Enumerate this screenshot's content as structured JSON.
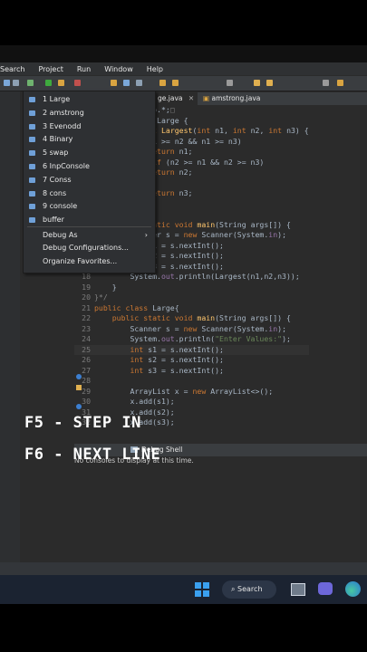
{
  "menubar": [
    "Search",
    "Project",
    "Run",
    "Window",
    "Help"
  ],
  "tabs": [
    "ge.java",
    "amstrong.java"
  ],
  "editor": {
    "lines": [
      {
        "n": "",
        "html": "           <span class='pl'>.io.*;</span><span class='cm'>□</span>"
      },
      {
        "n": "",
        "html": "           <span class='kw'>ss</span> <span class='pl'>Large {</span>"
      },
      {
        "n": "",
        "html": "           <span class='kw'>int</span> <span class='fn'>Largest</span><span class='pl'>(</span><span class='kw'>int</span> <span class='pl'>n1, </span><span class='kw'>int</span> <span class='pl'>n2, </span><span class='kw'>int</span> <span class='pl'>n3) {</span>"
      },
      {
        "n": "",
        "html": "           <span class='pl'>(n1 >= n2 && n1 >= n3)</span>"
      },
      {
        "n": "",
        "html": "            <span class='kw'>return</span> <span class='pl'>n1;</span>"
      },
      {
        "n": "",
        "html": "           <span class='kw'>e if</span> <span class='pl'>(n2 >= n1 && n2 >= n3)</span>"
      },
      {
        "n": "",
        "html": "            <span class='kw'>return</span> <span class='pl'>n2;</span>"
      },
      {
        "n": "",
        "html": ""
      },
      {
        "n": "",
        "html": "            <span class='kw'>return</span> <span class='pl'>n3;</span>"
      },
      {
        "n": "",
        "html": ""
      },
      {
        "n": "",
        "html": ""
      },
      {
        "n": "",
        "html": "           <span class='kw'>static void</span> <span class='fn'>main</span><span class='pl'>(String </span><span class='pl'>args[]) {</span>"
      },
      {
        "n": "",
        "html": "           <span class='pl'>nner s = </span><span class='kw'>new</span> <span class='pl'>Scanner(System.</span><span class='var'>in</span><span class='pl'>);</span>"
      },
      {
        "n": "",
        "html": "            <span class='pl'>n1 = s.nextInt();</span>"
      },
      {
        "n": "",
        "html": "            <span class='pl'>n2 = s.nextInt();</span>"
      },
      {
        "n": "",
        "html": "            <span class='pl'>n3 = s.nextInt();</span>"
      },
      {
        "n": "18",
        "html": "        <span class='pl'>System.</span><span class='var'>out</span><span class='pl'>.println(Largest(n1,n2,n3));</span>"
      },
      {
        "n": "19",
        "html": "    <span class='pl'>}</span>"
      },
      {
        "n": "20",
        "html": "<span class='cm'>}*/</span>"
      },
      {
        "n": "21",
        "html": "<span class='kw'>public class</span> <span class='pl'>Large{</span>"
      },
      {
        "n": "22",
        "html": "    <span class='kw'>public static void</span> <span class='fn'>main</span><span class='pl'>(String </span><span class='pl'>args[]) {</span>"
      },
      {
        "n": "23",
        "html": "        <span class='pl'>Scanner </span><span class='pl'>s</span><span class='pl'> = </span><span class='kw'>new</span> <span class='pl'>Scanner(System.</span><span class='var'>in</span><span class='pl'>);</span>"
      },
      {
        "n": "24",
        "html": "        <span class='pl'>System.</span><span class='var'>out</span><span class='pl'>.println(</span><span class='str'>\"Enter Values:\"</span><span class='pl'>);</span>"
      },
      {
        "n": "25",
        "html": "        <span class='kw'>int</span> <span class='pl'>s1 = s.nextInt();</span>"
      },
      {
        "n": "26",
        "html": "        <span class='kw'>int</span> <span class='pl'>s2 = s.nextInt();</span>"
      },
      {
        "n": "27",
        "html": "        <span class='kw'>int</span> <span class='pl'>s3 = s.nextInt();</span>"
      },
      {
        "n": "28",
        "html": ""
      },
      {
        "n": "29",
        "html": "        <span class='pl'>ArrayList<Integer> x = </span><span class='kw'>new</span> <span class='pl'>ArrayList<>();</span>"
      },
      {
        "n": "30",
        "html": "        <span class='pl'>x.add(s1);</span>"
      },
      {
        "n": "31",
        "html": "        <span class='pl'>x.add(s2);</span>"
      },
      {
        "n": "32",
        "html": "        <span class='pl'>x.add(s3);</span>"
      }
    ]
  },
  "run_menu": {
    "items": [
      "1 Large",
      "2 amstrong",
      "3 Evenodd",
      "4 Binary",
      "5 swap",
      "6 InpConsole",
      "7 Conss",
      "8 cons",
      "9 console",
      "buffer"
    ],
    "debug_as": "Debug As",
    "debug_configs": "Debug Configurations...",
    "organize": "Organize Favorites..."
  },
  "console": {
    "tab_label": "Debug Shell",
    "message": "No consoles to display at this time."
  },
  "taskbar": {
    "search_label": "Search"
  },
  "overlay": {
    "line1": "F5 - STEP IN",
    "line2": "F6 - NEXT LINE"
  },
  "colors": {
    "background": "#000000",
    "editor_bg": "#2b2b2b",
    "keyword": "#cc7832",
    "string": "#6a8759"
  }
}
